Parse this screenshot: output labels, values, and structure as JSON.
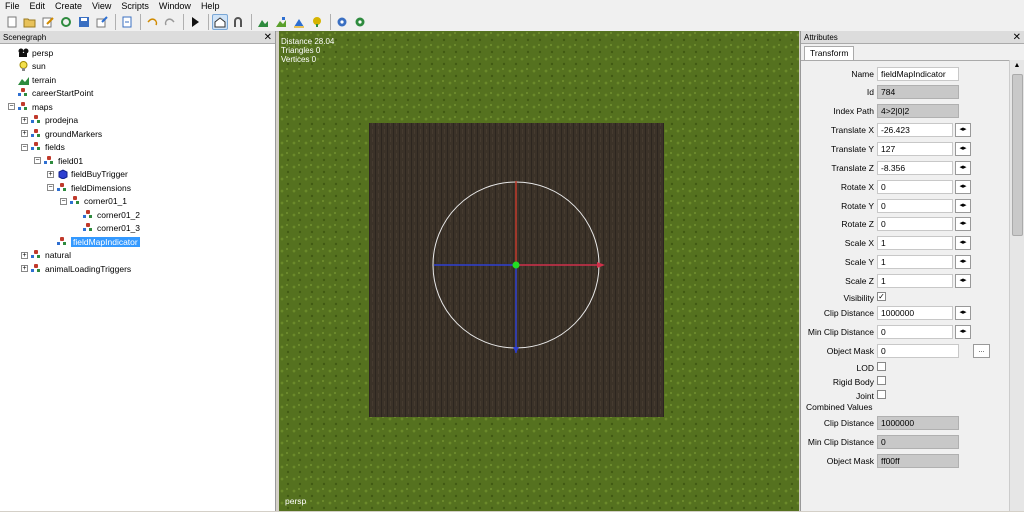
{
  "menu": [
    "File",
    "Edit",
    "Create",
    "View",
    "Scripts",
    "Window",
    "Help"
  ],
  "scenegraph": {
    "title": "Scenegraph",
    "nodes": [
      {
        "label": "persp",
        "icon": "camera-icon",
        "indent": 0,
        "expander": ""
      },
      {
        "label": "sun",
        "icon": "light-bulb-icon",
        "indent": 0,
        "expander": ""
      },
      {
        "label": "terrain",
        "icon": "terrain-icon",
        "indent": 0,
        "expander": ""
      },
      {
        "label": "careerStartPoint",
        "icon": "transform-group-icon",
        "indent": 0,
        "expander": ""
      },
      {
        "label": "maps",
        "icon": "transform-group-icon",
        "indent": 0,
        "expander": "−"
      },
      {
        "label": "prodejna",
        "icon": "transform-group-icon",
        "indent": 1,
        "expander": "+"
      },
      {
        "label": "groundMarkers",
        "icon": "transform-group-icon",
        "indent": 1,
        "expander": "+"
      },
      {
        "label": "fields",
        "icon": "transform-group-icon",
        "indent": 1,
        "expander": "−"
      },
      {
        "label": "field01",
        "icon": "transform-group-icon",
        "indent": 2,
        "expander": "−"
      },
      {
        "label": "fieldBuyTrigger",
        "icon": "cube-icon",
        "indent": 3,
        "expander": "+"
      },
      {
        "label": "fieldDimensions",
        "icon": "transform-group-icon",
        "indent": 3,
        "expander": "−"
      },
      {
        "label": "corner01_1",
        "icon": "transform-group-icon",
        "indent": 4,
        "expander": "−"
      },
      {
        "label": "corner01_2",
        "icon": "transform-group-icon",
        "indent": 5,
        "expander": ""
      },
      {
        "label": "corner01_3",
        "icon": "transform-group-icon",
        "indent": 5,
        "expander": ""
      },
      {
        "label": "fieldMapIndicator",
        "icon": "transform-group-icon",
        "indent": 3,
        "expander": "",
        "selected": true
      },
      {
        "label": "natural",
        "icon": "transform-group-icon",
        "indent": 1,
        "expander": "+"
      },
      {
        "label": "animalLoadingTriggers",
        "icon": "transform-group-icon",
        "indent": 1,
        "expander": "+"
      }
    ]
  },
  "viewport": {
    "stats": [
      "Distance 28.04",
      "Triangles 0",
      "Vertices 0"
    ],
    "camera": "persp"
  },
  "attributes": {
    "title": "Attributes",
    "tab": "Transform",
    "name_label": "Name",
    "name": "fieldMapIndicator",
    "id_label": "Id",
    "id": "784",
    "indexpath_label": "Index Path",
    "index_path": "4>2|0|2",
    "tx_label": "Translate X",
    "tx": "-26.423",
    "ty_label": "Translate Y",
    "ty": "127",
    "tz_label": "Translate Z",
    "tz": "-8.356",
    "rx_label": "Rotate X",
    "rx": "0",
    "ry_label": "Rotate Y",
    "ry": "0",
    "rz_label": "Rotate Z",
    "rz": "0",
    "sx_label": "Scale X",
    "sx": "1",
    "sy_label": "Scale Y",
    "sy": "1",
    "sz_label": "Scale Z",
    "sz": "1",
    "visibility_label": "Visibility",
    "visibility": true,
    "clip_label": "Clip Distance",
    "clip": "1000000",
    "minclip_label": "Min Clip Distance",
    "minclip": "0",
    "mask_label": "Object Mask",
    "mask": "0",
    "lod_label": "LOD",
    "lod": false,
    "rigid_label": "Rigid Body",
    "rigid": false,
    "joint_label": "Joint",
    "joint": false,
    "combined_label": "Combined Values",
    "c_clip_label": "Clip Distance",
    "c_clip": "1000000",
    "c_minclip_label": "Min Clip Distance",
    "c_minclip": "0",
    "c_mask_label": "Object Mask",
    "c_mask": "ff00ff",
    "browse": "..."
  }
}
